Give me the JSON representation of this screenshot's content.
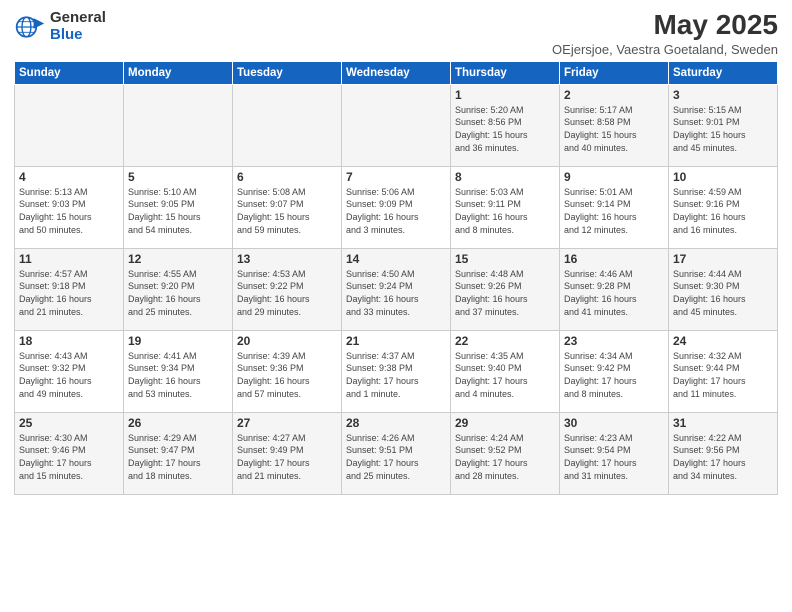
{
  "header": {
    "logo_general": "General",
    "logo_blue": "Blue",
    "title": "May 2025",
    "subtitle": "OEjersjoe, Vaestra Goetaland, Sweden"
  },
  "weekdays": [
    "Sunday",
    "Monday",
    "Tuesday",
    "Wednesday",
    "Thursday",
    "Friday",
    "Saturday"
  ],
  "weeks": [
    [
      {
        "day": "",
        "info": ""
      },
      {
        "day": "",
        "info": ""
      },
      {
        "day": "",
        "info": ""
      },
      {
        "day": "",
        "info": ""
      },
      {
        "day": "1",
        "info": "Sunrise: 5:20 AM\nSunset: 8:56 PM\nDaylight: 15 hours\nand 36 minutes."
      },
      {
        "day": "2",
        "info": "Sunrise: 5:17 AM\nSunset: 8:58 PM\nDaylight: 15 hours\nand 40 minutes."
      },
      {
        "day": "3",
        "info": "Sunrise: 5:15 AM\nSunset: 9:01 PM\nDaylight: 15 hours\nand 45 minutes."
      }
    ],
    [
      {
        "day": "4",
        "info": "Sunrise: 5:13 AM\nSunset: 9:03 PM\nDaylight: 15 hours\nand 50 minutes."
      },
      {
        "day": "5",
        "info": "Sunrise: 5:10 AM\nSunset: 9:05 PM\nDaylight: 15 hours\nand 54 minutes."
      },
      {
        "day": "6",
        "info": "Sunrise: 5:08 AM\nSunset: 9:07 PM\nDaylight: 15 hours\nand 59 minutes."
      },
      {
        "day": "7",
        "info": "Sunrise: 5:06 AM\nSunset: 9:09 PM\nDaylight: 16 hours\nand 3 minutes."
      },
      {
        "day": "8",
        "info": "Sunrise: 5:03 AM\nSunset: 9:11 PM\nDaylight: 16 hours\nand 8 minutes."
      },
      {
        "day": "9",
        "info": "Sunrise: 5:01 AM\nSunset: 9:14 PM\nDaylight: 16 hours\nand 12 minutes."
      },
      {
        "day": "10",
        "info": "Sunrise: 4:59 AM\nSunset: 9:16 PM\nDaylight: 16 hours\nand 16 minutes."
      }
    ],
    [
      {
        "day": "11",
        "info": "Sunrise: 4:57 AM\nSunset: 9:18 PM\nDaylight: 16 hours\nand 21 minutes."
      },
      {
        "day": "12",
        "info": "Sunrise: 4:55 AM\nSunset: 9:20 PM\nDaylight: 16 hours\nand 25 minutes."
      },
      {
        "day": "13",
        "info": "Sunrise: 4:53 AM\nSunset: 9:22 PM\nDaylight: 16 hours\nand 29 minutes."
      },
      {
        "day": "14",
        "info": "Sunrise: 4:50 AM\nSunset: 9:24 PM\nDaylight: 16 hours\nand 33 minutes."
      },
      {
        "day": "15",
        "info": "Sunrise: 4:48 AM\nSunset: 9:26 PM\nDaylight: 16 hours\nand 37 minutes."
      },
      {
        "day": "16",
        "info": "Sunrise: 4:46 AM\nSunset: 9:28 PM\nDaylight: 16 hours\nand 41 minutes."
      },
      {
        "day": "17",
        "info": "Sunrise: 4:44 AM\nSunset: 9:30 PM\nDaylight: 16 hours\nand 45 minutes."
      }
    ],
    [
      {
        "day": "18",
        "info": "Sunrise: 4:43 AM\nSunset: 9:32 PM\nDaylight: 16 hours\nand 49 minutes."
      },
      {
        "day": "19",
        "info": "Sunrise: 4:41 AM\nSunset: 9:34 PM\nDaylight: 16 hours\nand 53 minutes."
      },
      {
        "day": "20",
        "info": "Sunrise: 4:39 AM\nSunset: 9:36 PM\nDaylight: 16 hours\nand 57 minutes."
      },
      {
        "day": "21",
        "info": "Sunrise: 4:37 AM\nSunset: 9:38 PM\nDaylight: 17 hours\nand 1 minute."
      },
      {
        "day": "22",
        "info": "Sunrise: 4:35 AM\nSunset: 9:40 PM\nDaylight: 17 hours\nand 4 minutes."
      },
      {
        "day": "23",
        "info": "Sunrise: 4:34 AM\nSunset: 9:42 PM\nDaylight: 17 hours\nand 8 minutes."
      },
      {
        "day": "24",
        "info": "Sunrise: 4:32 AM\nSunset: 9:44 PM\nDaylight: 17 hours\nand 11 minutes."
      }
    ],
    [
      {
        "day": "25",
        "info": "Sunrise: 4:30 AM\nSunset: 9:46 PM\nDaylight: 17 hours\nand 15 minutes."
      },
      {
        "day": "26",
        "info": "Sunrise: 4:29 AM\nSunset: 9:47 PM\nDaylight: 17 hours\nand 18 minutes."
      },
      {
        "day": "27",
        "info": "Sunrise: 4:27 AM\nSunset: 9:49 PM\nDaylight: 17 hours\nand 21 minutes."
      },
      {
        "day": "28",
        "info": "Sunrise: 4:26 AM\nSunset: 9:51 PM\nDaylight: 17 hours\nand 25 minutes."
      },
      {
        "day": "29",
        "info": "Sunrise: 4:24 AM\nSunset: 9:52 PM\nDaylight: 17 hours\nand 28 minutes."
      },
      {
        "day": "30",
        "info": "Sunrise: 4:23 AM\nSunset: 9:54 PM\nDaylight: 17 hours\nand 31 minutes."
      },
      {
        "day": "31",
        "info": "Sunrise: 4:22 AM\nSunset: 9:56 PM\nDaylight: 17 hours\nand 34 minutes."
      }
    ]
  ]
}
